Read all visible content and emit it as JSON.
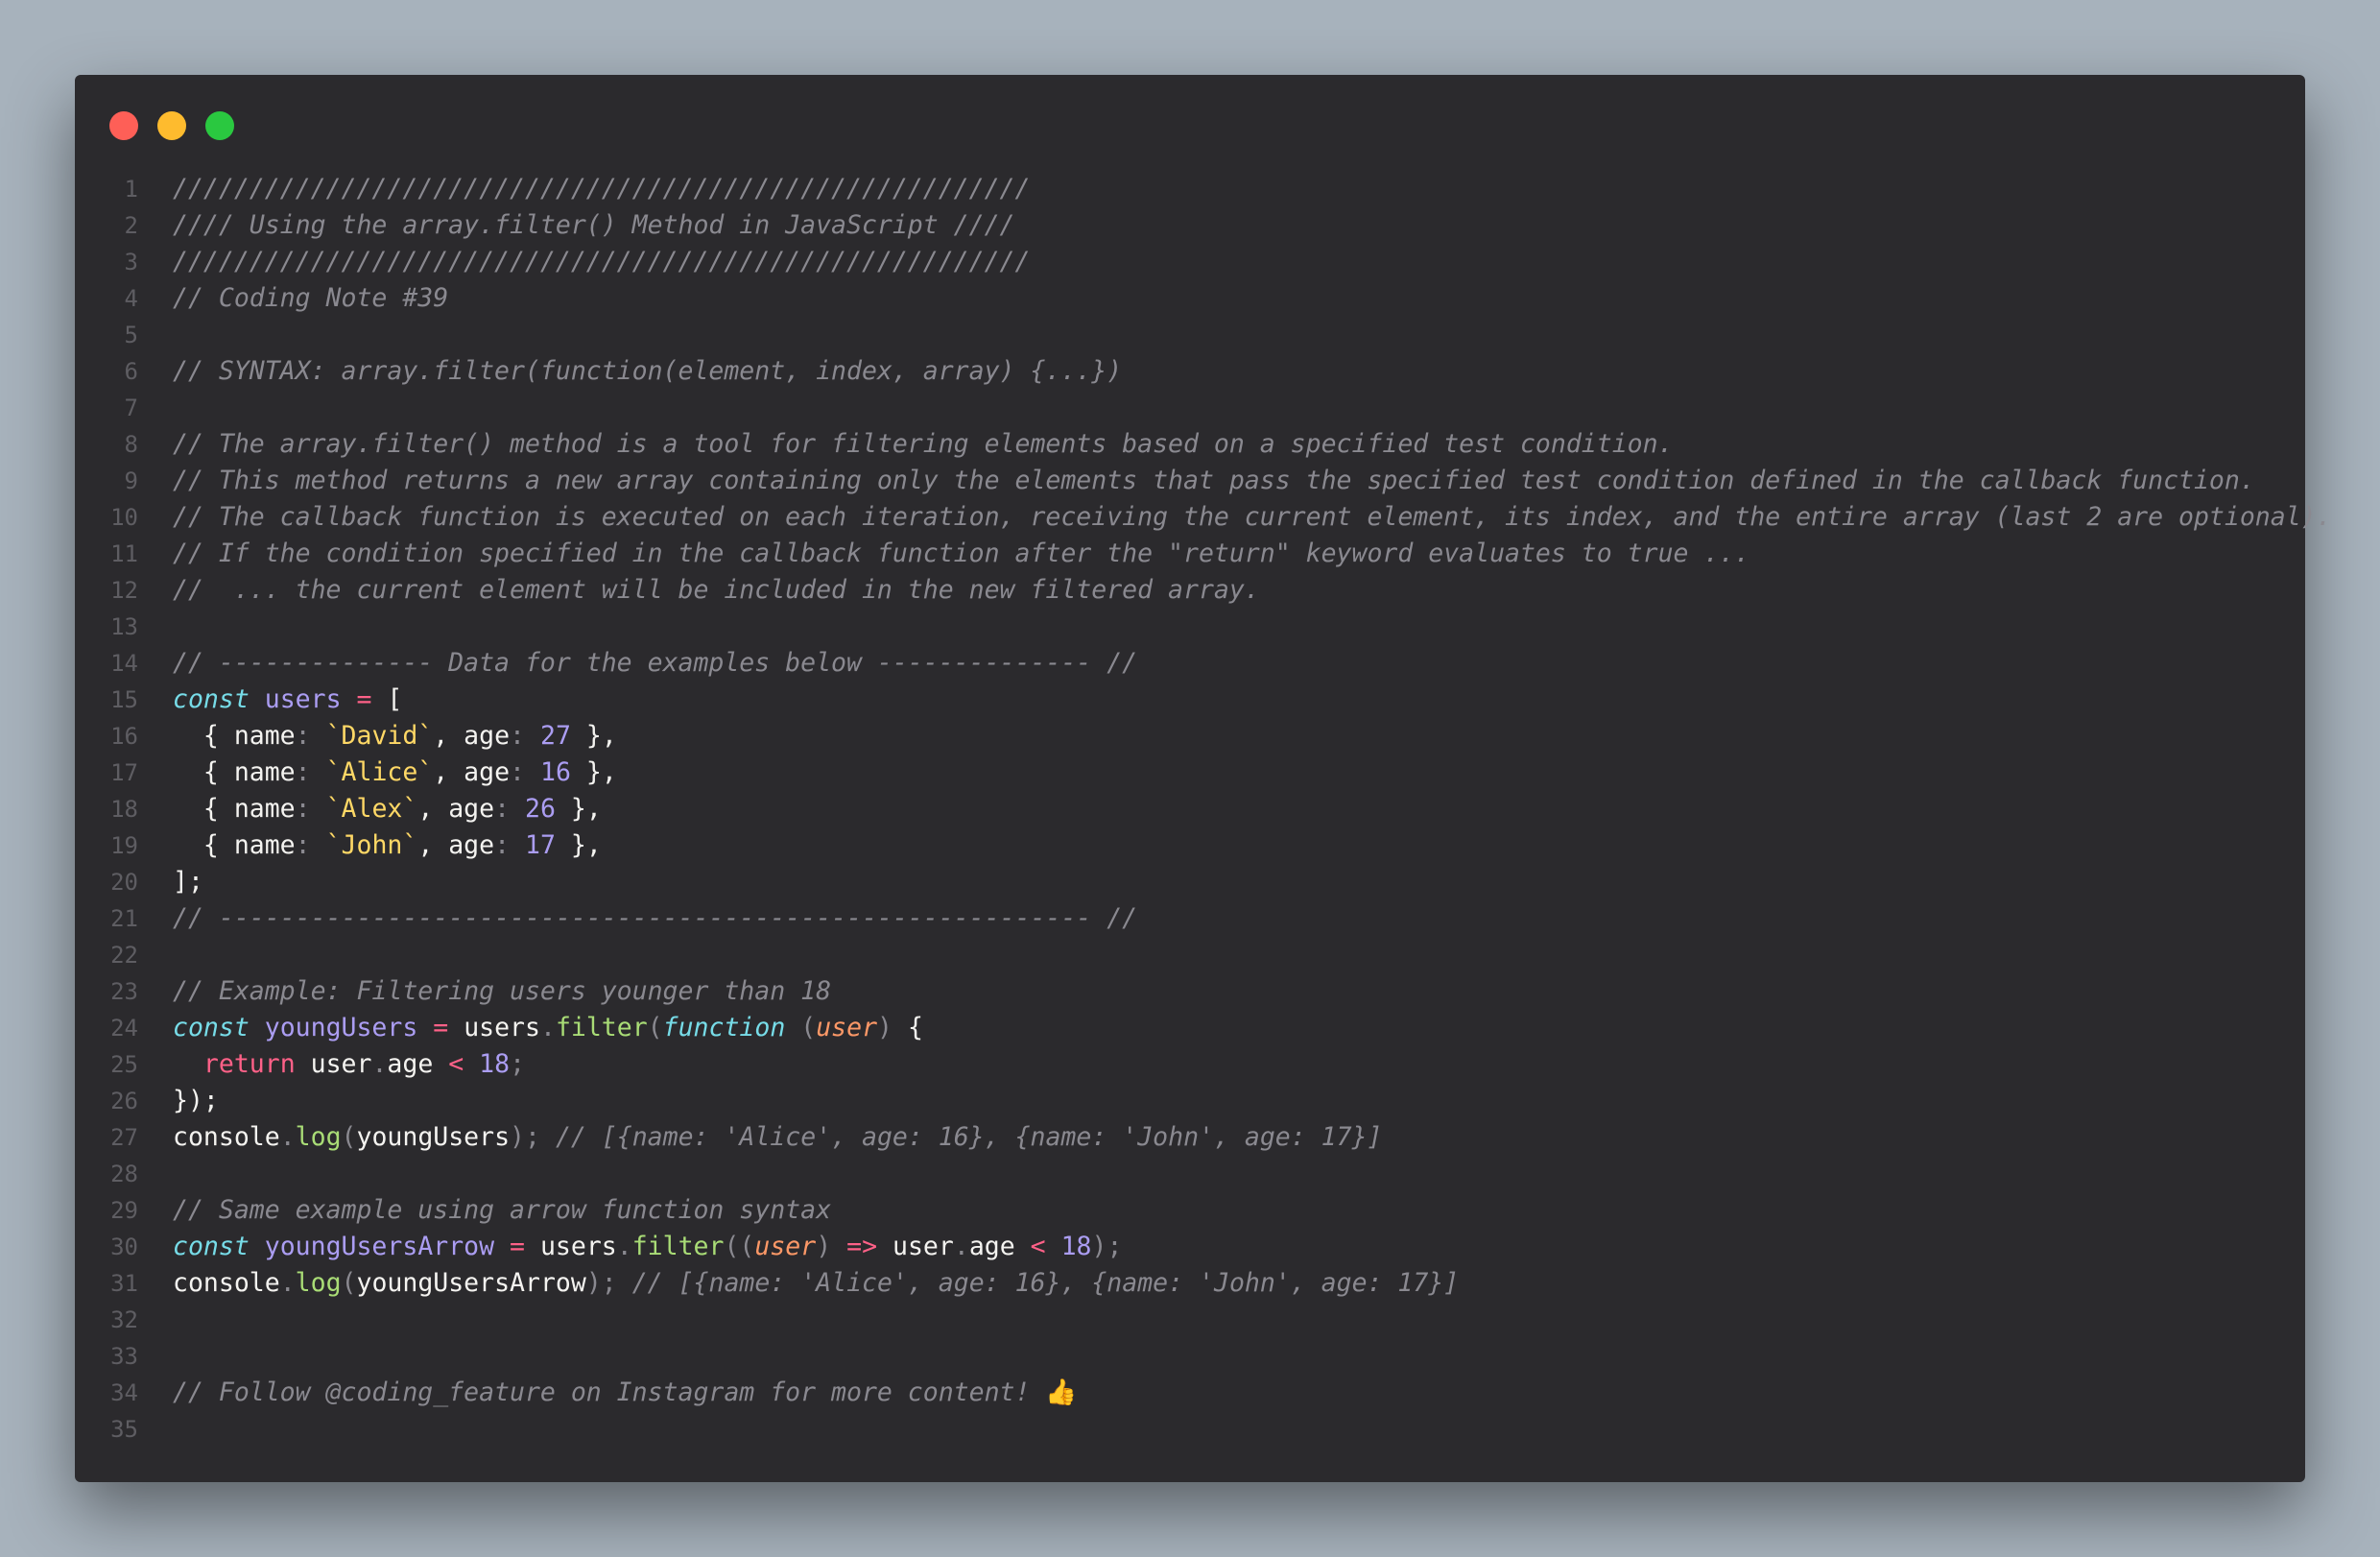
{
  "window": {
    "controls": [
      "close",
      "minimize",
      "maximize"
    ],
    "colors": {
      "close": "#fe5f57",
      "minimize": "#febb2e",
      "maximize": "#2ac840"
    }
  },
  "code": {
    "lines": [
      [
        [
          "c",
          "////////////////////////////////////////////////////////"
        ]
      ],
      [
        [
          "c",
          "//// Using the array.filter() Method in JavaScript ////"
        ]
      ],
      [
        [
          "c",
          "////////////////////////////////////////////////////////"
        ]
      ],
      [
        [
          "c",
          "// Coding Note #39"
        ]
      ],
      [],
      [
        [
          "c",
          "// SYNTAX: array.filter(function(element, index, array) {...})"
        ]
      ],
      [],
      [
        [
          "c",
          "// The array.filter() method is a tool for filtering elements based on a specified test condition."
        ]
      ],
      [
        [
          "c",
          "// This method returns a new array containing only the elements that pass the specified test condition defined in the callback function."
        ]
      ],
      [
        [
          "c",
          "// The callback function is executed on each iteration, receiving the current element, its index, and the entire array (last 2 are optional)."
        ]
      ],
      [
        [
          "c",
          "// If the condition specified in the callback function after the \"return\" keyword evaluates to true ..."
        ]
      ],
      [
        [
          "c",
          "//  ... the current element will be included in the new filtered array."
        ]
      ],
      [],
      [
        [
          "c",
          "// -------------- Data for the examples below -------------- //"
        ]
      ],
      [
        [
          "k",
          "const"
        ],
        [
          "w",
          " "
        ],
        [
          "v",
          "users"
        ],
        [
          "w",
          " "
        ],
        [
          "o",
          "="
        ],
        [
          "w",
          " ["
        ]
      ],
      [
        [
          "w",
          "  { name"
        ],
        [
          "g",
          ":"
        ],
        [
          "w",
          " "
        ],
        [
          "s",
          "`David`"
        ],
        [
          "w",
          ", age"
        ],
        [
          "g",
          ":"
        ],
        [
          "w",
          " "
        ],
        [
          "n",
          "27"
        ],
        [
          "w",
          " },"
        ]
      ],
      [
        [
          "w",
          "  { name"
        ],
        [
          "g",
          ":"
        ],
        [
          "w",
          " "
        ],
        [
          "s",
          "`Alice`"
        ],
        [
          "w",
          ", age"
        ],
        [
          "g",
          ":"
        ],
        [
          "w",
          " "
        ],
        [
          "n",
          "16"
        ],
        [
          "w",
          " },"
        ]
      ],
      [
        [
          "w",
          "  { name"
        ],
        [
          "g",
          ":"
        ],
        [
          "w",
          " "
        ],
        [
          "s",
          "`Alex`"
        ],
        [
          "w",
          ", age"
        ],
        [
          "g",
          ":"
        ],
        [
          "w",
          " "
        ],
        [
          "n",
          "26"
        ],
        [
          "w",
          " },"
        ]
      ],
      [
        [
          "w",
          "  { name"
        ],
        [
          "g",
          ":"
        ],
        [
          "w",
          " "
        ],
        [
          "s",
          "`John`"
        ],
        [
          "w",
          ", age"
        ],
        [
          "g",
          ":"
        ],
        [
          "w",
          " "
        ],
        [
          "n",
          "17"
        ],
        [
          "w",
          " },"
        ]
      ],
      [
        [
          "w",
          "];"
        ]
      ],
      [
        [
          "c",
          "// --------------------------------------------------------- //"
        ]
      ],
      [],
      [
        [
          "c",
          "// Example: Filtering users younger than 18"
        ]
      ],
      [
        [
          "k",
          "const"
        ],
        [
          "w",
          " "
        ],
        [
          "v",
          "youngUsers"
        ],
        [
          "w",
          " "
        ],
        [
          "o",
          "="
        ],
        [
          "w",
          " users"
        ],
        [
          "g",
          "."
        ],
        [
          "m",
          "filter"
        ],
        [
          "g",
          "("
        ],
        [
          "k",
          "function"
        ],
        [
          "w",
          " "
        ],
        [
          "g",
          "("
        ],
        [
          "p",
          "user"
        ],
        [
          "g",
          ")"
        ],
        [
          "w",
          " {"
        ]
      ],
      [
        [
          "w",
          "  "
        ],
        [
          "r",
          "return"
        ],
        [
          "w",
          " user"
        ],
        [
          "g",
          "."
        ],
        [
          "w",
          "age "
        ],
        [
          "o",
          "<"
        ],
        [
          "w",
          " "
        ],
        [
          "n",
          "18"
        ],
        [
          "g",
          ";"
        ]
      ],
      [
        [
          "w",
          "});"
        ]
      ],
      [
        [
          "w",
          "console"
        ],
        [
          "g",
          "."
        ],
        [
          "m",
          "log"
        ],
        [
          "g",
          "("
        ],
        [
          "w",
          "youngUsers"
        ],
        [
          "g",
          ");"
        ],
        [
          "w",
          " "
        ],
        [
          "c",
          "// [{name: 'Alice', age: 16}, {name: 'John', age: 17}]"
        ]
      ],
      [],
      [
        [
          "c",
          "// Same example using arrow function syntax"
        ]
      ],
      [
        [
          "k",
          "const"
        ],
        [
          "w",
          " "
        ],
        [
          "v",
          "youngUsersArrow"
        ],
        [
          "w",
          " "
        ],
        [
          "o",
          "="
        ],
        [
          "w",
          " users"
        ],
        [
          "g",
          "."
        ],
        [
          "m",
          "filter"
        ],
        [
          "g",
          "(("
        ],
        [
          "p",
          "user"
        ],
        [
          "g",
          ")"
        ],
        [
          "w",
          " "
        ],
        [
          "o",
          "=>"
        ],
        [
          "w",
          " user"
        ],
        [
          "g",
          "."
        ],
        [
          "w",
          "age "
        ],
        [
          "o",
          "<"
        ],
        [
          "w",
          " "
        ],
        [
          "n",
          "18"
        ],
        [
          "g",
          ");"
        ]
      ],
      [
        [
          "w",
          "console"
        ],
        [
          "g",
          "."
        ],
        [
          "m",
          "log"
        ],
        [
          "g",
          "("
        ],
        [
          "w",
          "youngUsersArrow"
        ],
        [
          "g",
          ");"
        ],
        [
          "w",
          " "
        ],
        [
          "c",
          "// [{name: 'Alice', age: 16}, {name: 'John', age: 17}]"
        ]
      ],
      [],
      [],
      [
        [
          "c",
          "// Follow @coding_feature on Instagram for more content! "
        ],
        [
          "emoji",
          "👍"
        ]
      ],
      []
    ]
  }
}
